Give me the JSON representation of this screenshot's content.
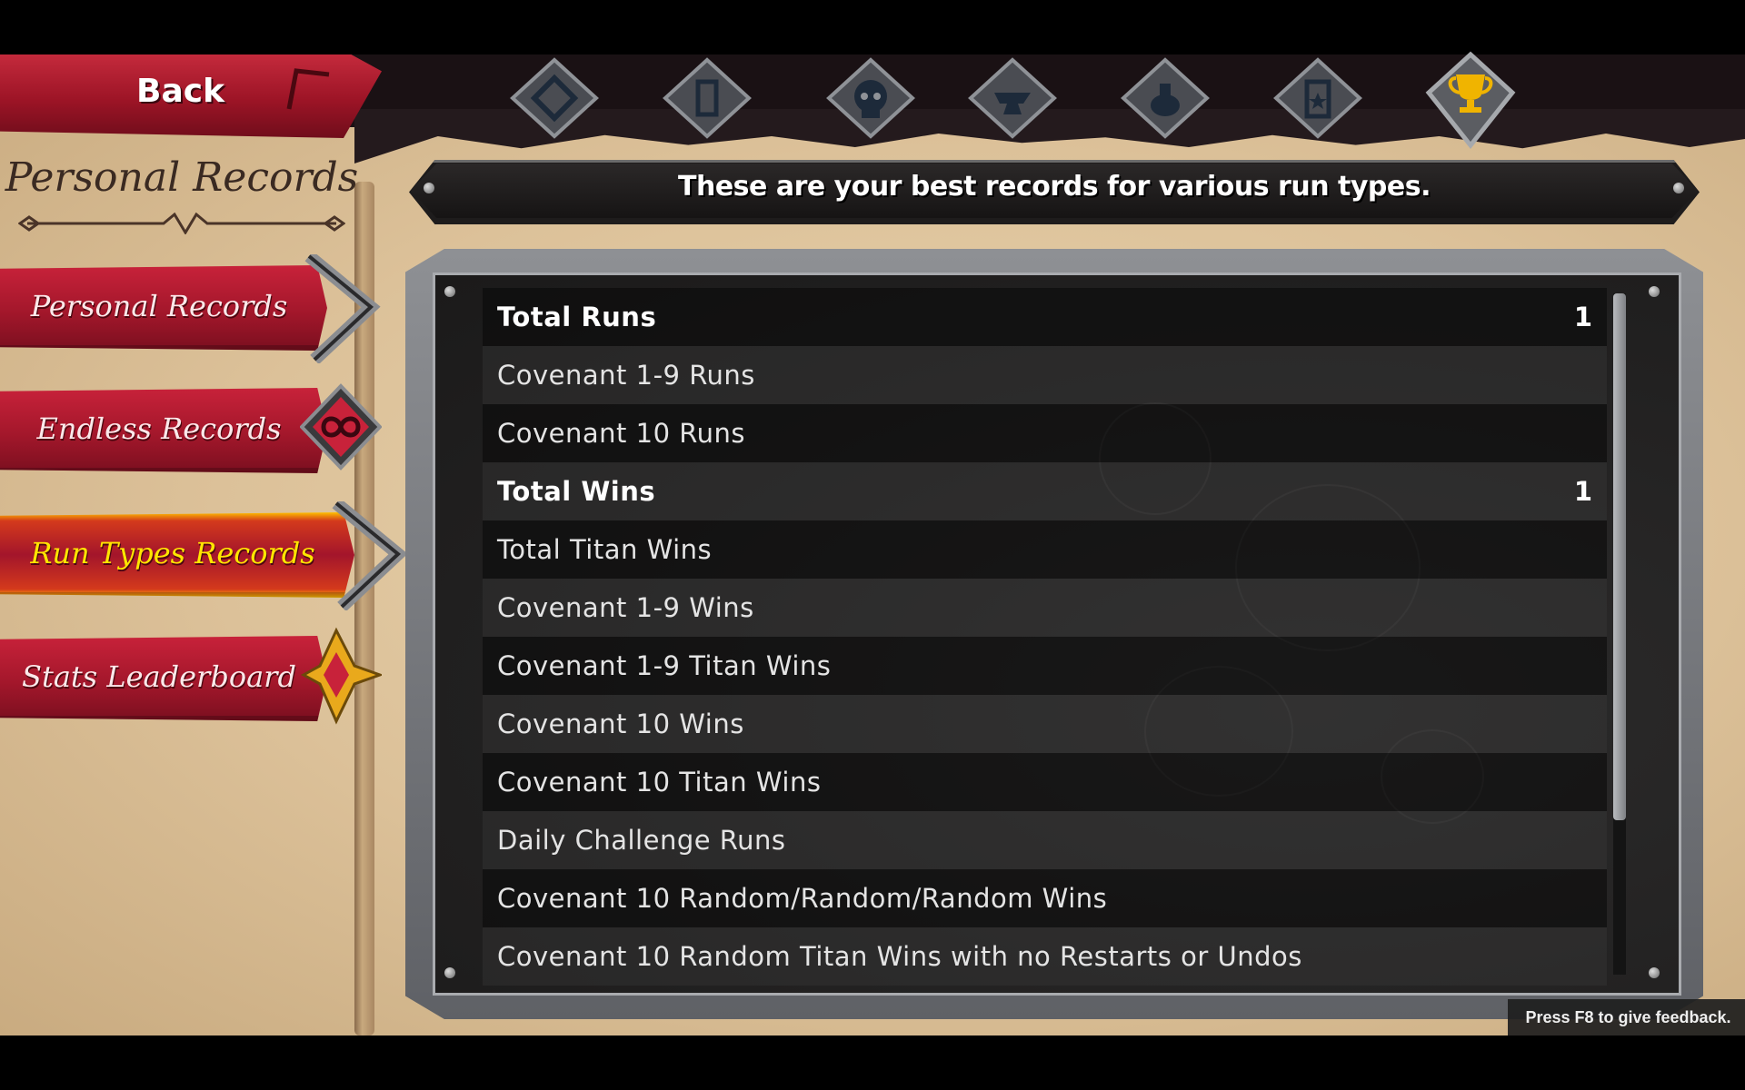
{
  "nav": {
    "back_label": "Back"
  },
  "sidebar": {
    "title": "Personal Records",
    "items": [
      {
        "label": "Personal Records",
        "icon": "chevron-right-icon",
        "active": false
      },
      {
        "label": "Endless Records",
        "icon": "infinity-icon",
        "active": false
      },
      {
        "label": "Run Types Records",
        "icon": "chevron-right-icon",
        "active": true
      },
      {
        "label": "Stats Leaderboard",
        "icon": "gem-star-icon",
        "active": false
      }
    ]
  },
  "category_tabs": [
    {
      "icon": "diamond-emblem-icon",
      "active": false
    },
    {
      "icon": "card-icon",
      "active": false
    },
    {
      "icon": "skull-icon",
      "active": false
    },
    {
      "icon": "anvil-icon",
      "active": false
    },
    {
      "icon": "potion-icon",
      "active": false
    },
    {
      "icon": "scroll-icon",
      "active": false
    },
    {
      "icon": "trophy-icon",
      "active": true
    }
  ],
  "header": {
    "text": "These are your best records for various run types."
  },
  "records": [
    {
      "label": "Total Runs",
      "value": "1",
      "strong": true
    },
    {
      "label": "Covenant 1-9 Runs",
      "value": "",
      "strong": false
    },
    {
      "label": "Covenant 10 Runs",
      "value": "",
      "strong": false
    },
    {
      "label": "Total Wins",
      "value": "1",
      "strong": true
    },
    {
      "label": "Total Titan Wins",
      "value": "",
      "strong": false
    },
    {
      "label": "Covenant 1-9 Wins",
      "value": "",
      "strong": false
    },
    {
      "label": "Covenant 1-9 Titan Wins",
      "value": "",
      "strong": false
    },
    {
      "label": "Covenant 10 Wins",
      "value": "",
      "strong": false
    },
    {
      "label": "Covenant 10 Titan Wins",
      "value": "",
      "strong": false
    },
    {
      "label": "Daily Challenge Runs",
      "value": "",
      "strong": false
    },
    {
      "label": "Covenant 10 Random/Random/Random Wins",
      "value": "",
      "strong": false
    },
    {
      "label": "Covenant 10 Random Titan Wins with no Restarts or Undos",
      "value": "",
      "strong": false
    }
  ],
  "footer": {
    "feedback": "Press F8 to give feedback."
  },
  "colors": {
    "menu_red": "#a3172b",
    "active_label": "#ffe600",
    "trophy": "#f0b400",
    "parchment": "#dcc199"
  }
}
